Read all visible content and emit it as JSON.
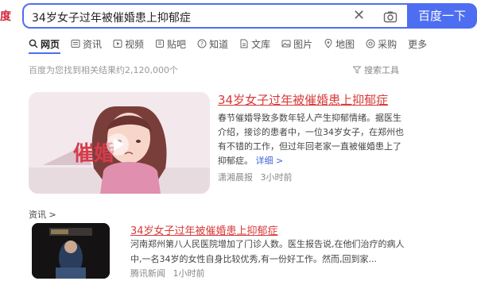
{
  "logo_fragment": "度",
  "search": {
    "query": "34岁女子过年被催婚患上抑郁症",
    "button_label": "百度一下"
  },
  "tabs": [
    {
      "label": "网页",
      "icon": "search-icon"
    },
    {
      "label": "资讯",
      "icon": "news-icon"
    },
    {
      "label": "视频",
      "icon": "video-icon"
    },
    {
      "label": "贴吧",
      "icon": "tieba-icon"
    },
    {
      "label": "知道",
      "icon": "question-icon"
    },
    {
      "label": "文库",
      "icon": "document-icon"
    },
    {
      "label": "图片",
      "icon": "image-icon"
    },
    {
      "label": "地图",
      "icon": "map-icon"
    },
    {
      "label": "采购",
      "icon": "purchase-icon"
    },
    {
      "label": "更多",
      "icon": ""
    }
  ],
  "result_count": "百度为您找到相关结果约2,120,000个",
  "tools_label": "搜索工具",
  "results": [
    {
      "title": "34岁女子过年被催婚患上抑郁症",
      "snippet": "春节催婚导致多数年轻人产生抑郁情绪。据医生介绍，接诊的患者中，一位34岁女子，在郑州也有不错的工作，但过年回老家一直被催婚患上了抑郁症。",
      "more_label": "详细 >",
      "source": "潇湘晨报",
      "time": "3小时前",
      "thumb_text": "催婚"
    },
    {
      "title": "34岁女子过年被催婚患上抑郁症",
      "snippet": "河南郑州第八人民医院增加了门诊人数。医生报告说,在他们治疗的病人中,一名34岁的女性自身比较优秀,有一份好工作。然而,回到家...",
      "source": "腾讯新闻",
      "time": "1小时前"
    }
  ],
  "news_section_label": "资讯 >"
}
